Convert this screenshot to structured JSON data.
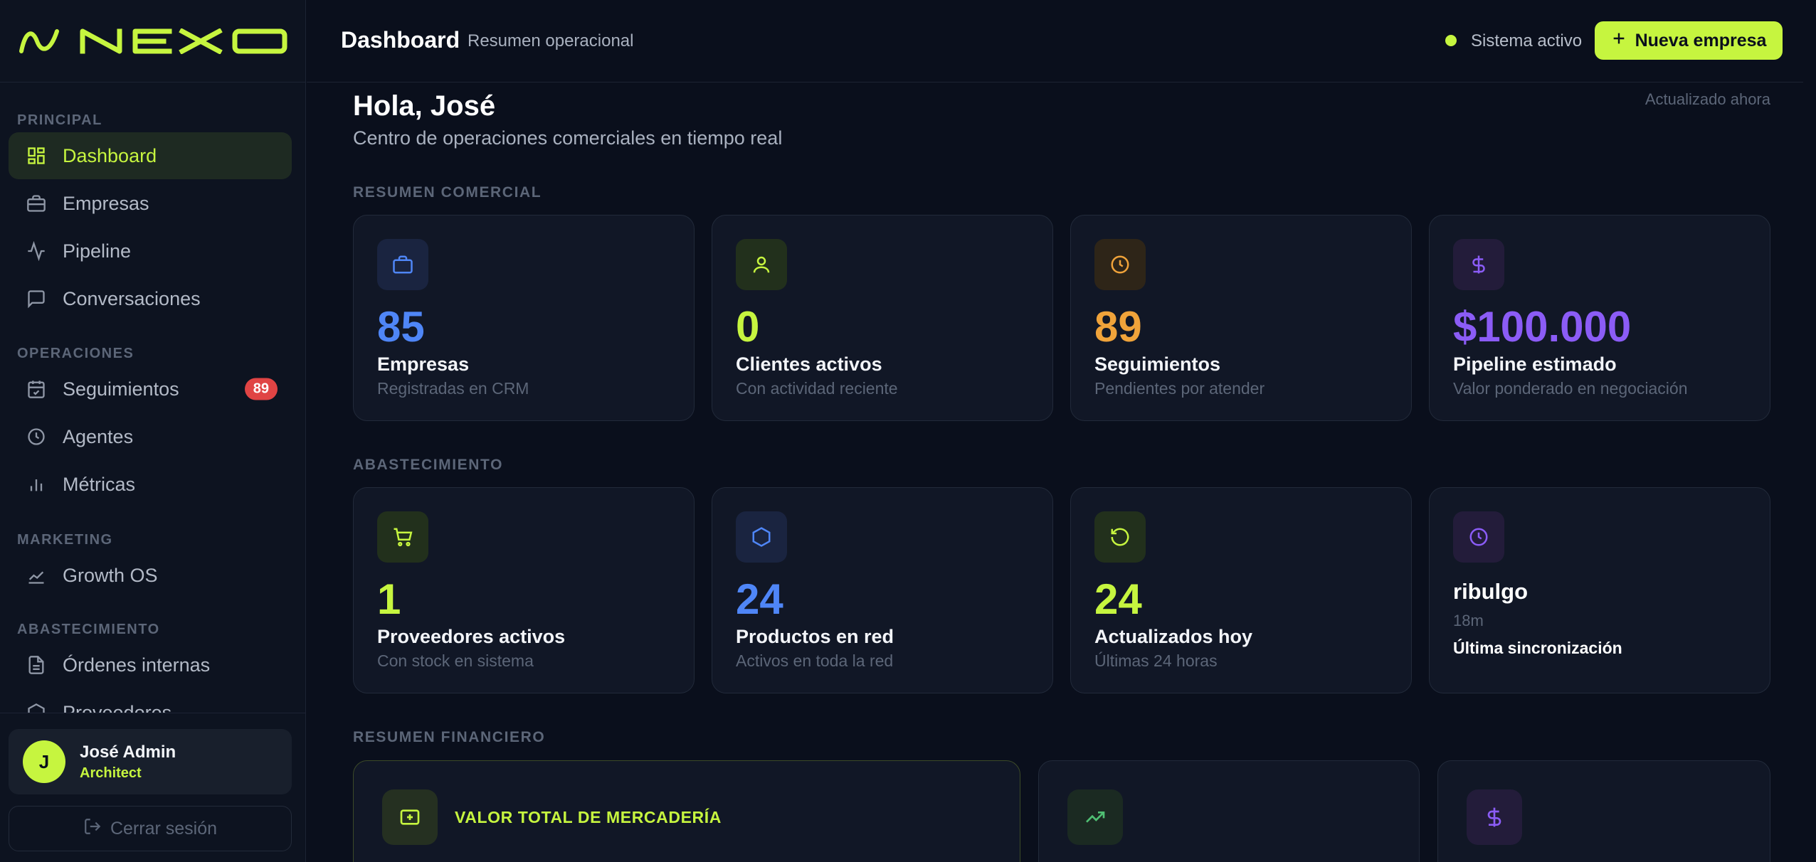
{
  "colors": {
    "accent": "#c6f53f",
    "blue": "#4f86f7",
    "orange": "#f0a33a",
    "purple": "#8b5cf6",
    "badge_red": "#e04444"
  },
  "brand": {
    "name": "NEXO"
  },
  "sidebar": {
    "sections": [
      {
        "label": "PRINCIPAL"
      },
      {
        "label": "OPERACIONES"
      },
      {
        "label": "MARKETING"
      },
      {
        "label": "ABASTECIMIENTO"
      }
    ],
    "items": [
      {
        "label": "Dashboard",
        "icon": "grid-icon"
      },
      {
        "label": "Empresas",
        "icon": "briefcase-icon"
      },
      {
        "label": "Pipeline",
        "icon": "activity-icon"
      },
      {
        "label": "Conversaciones",
        "icon": "message-icon"
      },
      {
        "label": "Seguimientos",
        "icon": "calendar-check-icon",
        "badge": "89"
      },
      {
        "label": "Agentes",
        "icon": "clock-icon"
      },
      {
        "label": "Métricas",
        "icon": "bar-chart-icon"
      },
      {
        "label": "Growth OS",
        "icon": "trending-up-icon"
      },
      {
        "label": "Órdenes internas",
        "icon": "file-text-icon"
      },
      {
        "label": "Proveedores",
        "icon": "box-icon"
      }
    ]
  },
  "user": {
    "initial": "J",
    "name": "José Admin",
    "role": "Architect",
    "logout_label": "Cerrar sesión"
  },
  "topbar": {
    "title": "Dashboard",
    "subtitle": "Resumen operacional",
    "status": "Sistema activo",
    "new_button": "Nueva empresa"
  },
  "main": {
    "greeting": "Hola, José",
    "greeting_sub": "Centro de operaciones comerciales en tiempo real",
    "updated": "Actualizado ahora",
    "sections": {
      "comercial": "RESUMEN COMERCIAL",
      "abastecimiento": "ABASTECIMIENTO",
      "financiero": "RESUMEN FINANCIERO"
    },
    "comercial_cards": [
      {
        "value": "85",
        "label": "Empresas",
        "desc": "Registradas en CRM",
        "icon": "briefcase-icon"
      },
      {
        "value": "0",
        "label": "Clientes activos",
        "desc": "Con actividad reciente",
        "icon": "user-icon"
      },
      {
        "value": "89",
        "label": "Seguimientos",
        "desc": "Pendientes por atender",
        "icon": "clock-icon"
      },
      {
        "value": "$100.000",
        "label": "Pipeline estimado",
        "desc": "Valor ponderado en negociación",
        "icon": "dollar-icon"
      }
    ],
    "abastecimiento_cards": [
      {
        "value": "1",
        "label": "Proveedores activos",
        "desc": "Con stock en sistema",
        "icon": "cart-icon"
      },
      {
        "value": "24",
        "label": "Productos en red",
        "desc": "Activos en toda la red",
        "icon": "hexagon-icon"
      },
      {
        "value": "24",
        "label": "Actualizados hoy",
        "desc": "Últimas 24 horas",
        "icon": "refresh-icon"
      },
      {
        "name": "ribulgo",
        "ago": "18m",
        "label": "Última sincronización",
        "icon": "clock-icon"
      }
    ],
    "financiero_cards": [
      {
        "title": "VALOR TOTAL DE MERCADERÍA",
        "icon": "plus-box-icon"
      },
      {
        "icon": "trending-up-icon"
      },
      {
        "icon": "dollar-icon"
      }
    ]
  }
}
